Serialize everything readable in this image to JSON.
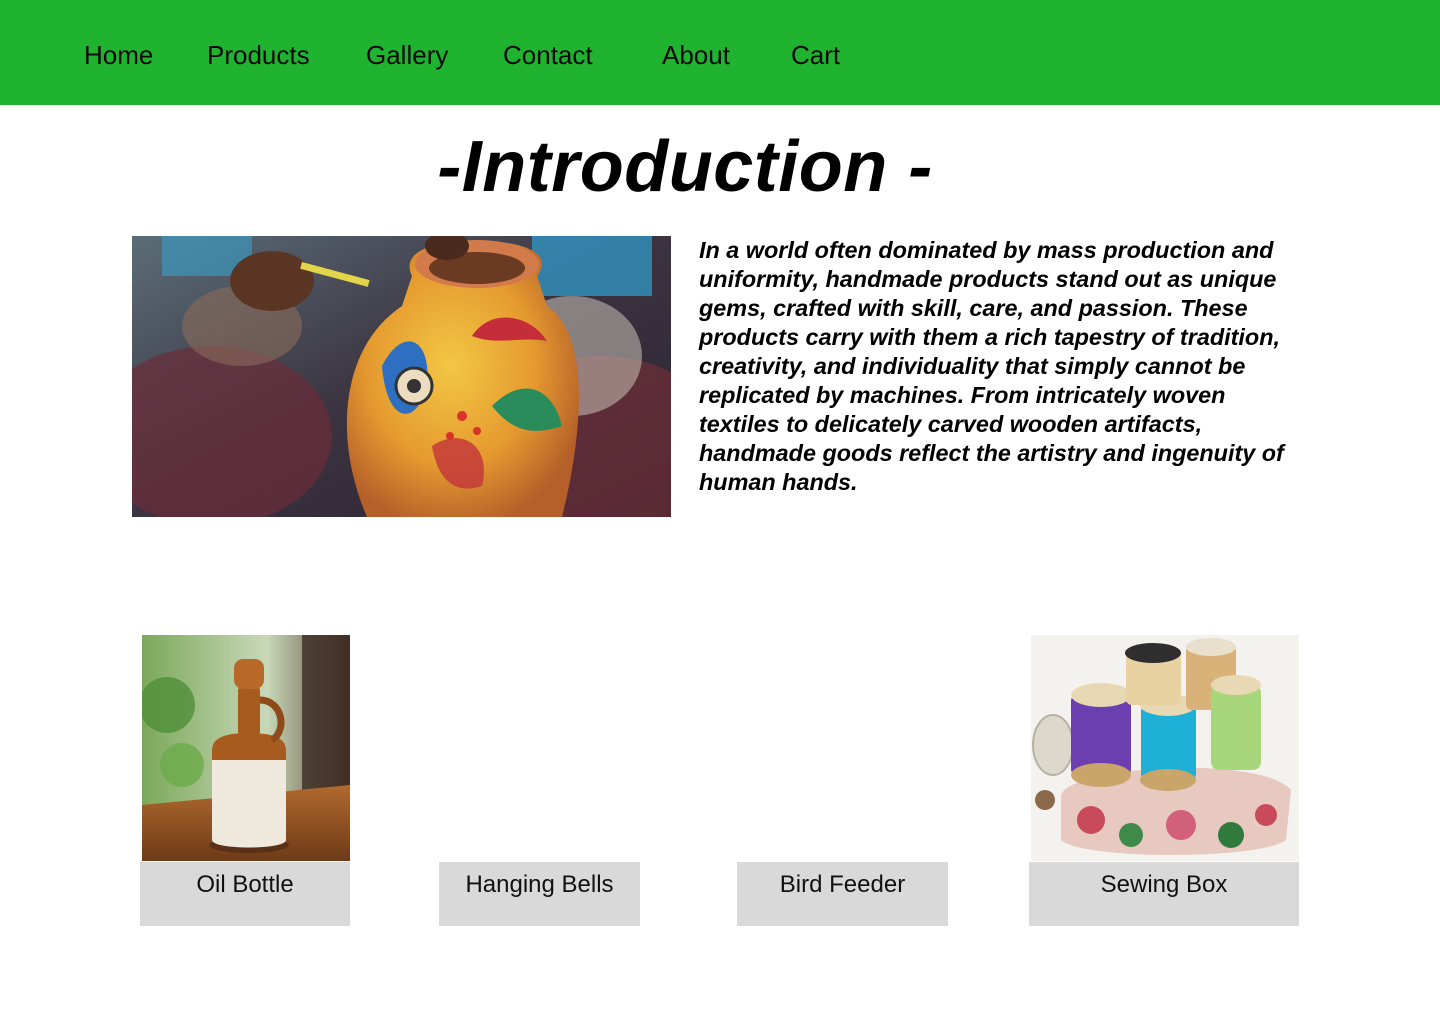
{
  "nav": {
    "items": [
      {
        "label": "Home"
      },
      {
        "label": "Products"
      },
      {
        "label": "Gallery"
      },
      {
        "label": "Contact"
      },
      {
        "label": "About"
      },
      {
        "label": "Cart"
      }
    ]
  },
  "colors": {
    "navbar": "#1fb32f",
    "card_label_bg": "#d9d9d9"
  },
  "intro": {
    "title": "-Introduction -",
    "body": "In a world often dominated by mass production and uniformity, handmade products stand out as unique gems, crafted with skill, care, and passion. These products carry with them a rich tapestry of tradition, creativity, and individuality that simply cannot be replicated by machines. From intricately woven textiles to delicately carved wooden artifacts, handmade goods reflect the artistry and ingenuity of human hands."
  },
  "products": [
    {
      "name": "Oil Bottle"
    },
    {
      "name": "Hanging Bells"
    },
    {
      "name": "Bird Feeder"
    },
    {
      "name": "Sewing Box"
    }
  ]
}
